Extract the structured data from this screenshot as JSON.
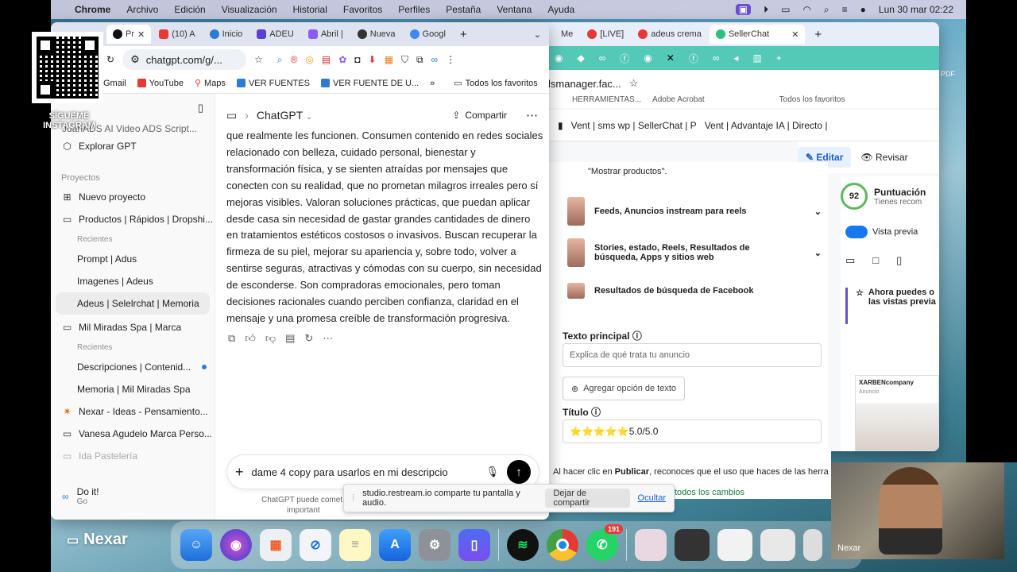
{
  "menubar": {
    "app": "Chrome",
    "items": [
      "Archivo",
      "Edición",
      "Visualización",
      "Historial",
      "Favoritos",
      "Perfiles",
      "Pestaña",
      "Ventana",
      "Ayuda"
    ],
    "datetime": "Lun 30 mar  02:22"
  },
  "overlay": {
    "qr_caption": "SÍGUEME INSTAGRAM",
    "nexar_label": "Nexar",
    "webcam_label": "Nexar"
  },
  "left_window": {
    "tabs": [
      "Pr",
      "(10) A",
      "Inicio",
      "ADEU",
      "Abril |",
      "Nueva",
      "Googl"
    ],
    "url": "chatgpt.com/g/...",
    "bookmarks": [
      "Gmail",
      "YouTube",
      "Maps",
      "VER FUENTES",
      "VER FUENTE DE U...",
      "Todos los favoritos"
    ],
    "sidebar": {
      "top_item": "JuanADS AI Video ADS Script...",
      "explore": "Explorar GPT",
      "projects_label": "Proyectos",
      "new_project": "Nuevo proyecto",
      "project1": "Productos | Rápidos | Dropshi...",
      "recent_label": "Recientes",
      "project1_items": [
        "Prompt | Adus",
        "Imagenes | Adeus",
        "Adeus | Selelrchat | Memoria"
      ],
      "project2": "Mil Miradas Spa | Marca",
      "project2_items": [
        "Descripciones | Contenid...",
        "Memoria | Mil Miradas Spa"
      ],
      "nexar_ideas": "Nexar - Ideas - Pensamiento...",
      "vanesa": "Vanesa Agudelo Marca Perso...",
      "ida": "Ida Pastelería",
      "doit_title": "Do it!",
      "doit_sub": "Go"
    },
    "chat": {
      "title": "ChatGPT",
      "share": "Compartir",
      "message": "que realmente les funcionen. Consumen contenido en redes sociales relacionado con belleza, cuidado personal, bienestar y transformación física, y se sienten atraídas por mensajes que conecten con su realidad, que no prometan milagros irreales pero sí mejoras visibles. Valoran soluciones prácticas, que puedan aplicar desde casa sin necesidad de gastar grandes cantidades de dinero en tratamientos estéticos costosos o invasivos. Buscan recuperar la firmeza de su piel, mejorar su apariencia y, sobre todo, volver a sentirse seguras, atractivas y cómodas con su cuerpo, sin necesidad de esconderse. Son compradoras emocionales, pero toman decisiones racionales cuando perciben confianza, claridad en el mensaje y una promesa creíble de transformación progresiva.",
      "input_value": "dame 4 copy para usarlos en mi descripcio",
      "disclaimer1": "ChatGPT puede comet",
      "disclaimer2": "important"
    }
  },
  "right_window": {
    "tabs": [
      "Me",
      "[LIVE]",
      "adeus crema",
      "SellerChat"
    ],
    "url_fragment": "lsmanager.fac...",
    "bookmarks": [
      "HERRAMIENTAS...",
      "Adobe Acrobat",
      "Todos los favoritos"
    ],
    "breadcrumb1": "Vent | sms wp | SellerChat | P",
    "breadcrumb2": "Vent | Advantaje IA | Directo |",
    "edit": "Editar",
    "review": "Revisar",
    "show_products": "\"Mostrar productos\".",
    "placements": [
      "Feeds, Anuncios instream para reels",
      "Stories, estado, Reels, Resultados de búsqueda, Apps y sitios web",
      "Resultados de búsqueda de Facebook"
    ],
    "primary_text_label": "Texto principal",
    "primary_text_placeholder": "Explica de qué trata tu anuncio",
    "add_text_option": "Agregar opción de texto",
    "title_label": "Título",
    "title_value": "⭐⭐⭐⭐⭐5.0/5.0",
    "score_value": "92",
    "score_label": "Puntuación",
    "score_sub": "Tienes recom",
    "preview_label": "Vista previa",
    "notice": "Ahora puedes o las vistas previa",
    "ad_brand": "XARBENcompany",
    "ad_sub": "Anuncio",
    "publish_notice_pre": "Al hacer clic en ",
    "publish_notice_bold": "Publicar",
    "publish_notice_post": ", reconoces que el uso que haces de las herra",
    "all_changes": "todos los cambios"
  },
  "share_bar": {
    "text": "studio.restream.io comparte tu pantalla y audio.",
    "stop": "Dejar de compartir",
    "hide": "Ocultar"
  },
  "dock": {
    "whatsapp_badge": "191"
  },
  "colors": {
    "meta_blue": "#1877f2",
    "chrome_tab_left": "#dfe3f0",
    "chrome_tab_right": "#e7eef9"
  }
}
